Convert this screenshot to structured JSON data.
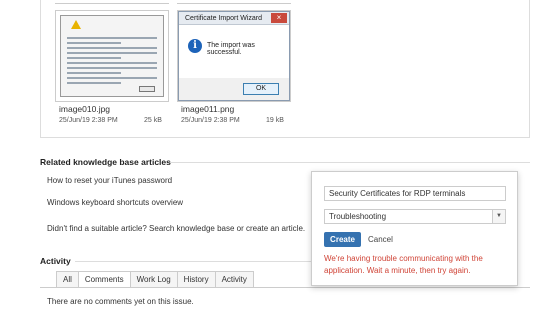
{
  "attachments": [
    {
      "name": "image010.jpg",
      "date": "25/Jun/19 2:38 PM",
      "size": "25 kB"
    },
    {
      "name": "image011.png",
      "date": "25/Jun/19 2:38 PM",
      "size": "19 kB"
    }
  ],
  "dialog_preview": {
    "title": "Certificate Import Wizard",
    "message": "The import was successful.",
    "ok_label": "OK"
  },
  "knowledge_base": {
    "heading": "Related knowledge base articles",
    "articles": [
      "How to reset your iTunes password",
      "Windows keyboard shortcuts overview"
    ],
    "suggest_text": "Didn't find a suitable article? Search knowledge base or create an article."
  },
  "activity": {
    "heading": "Activity",
    "tabs": [
      "All",
      "Comments",
      "Work Log",
      "History",
      "Activity"
    ],
    "active_tab": "Comments",
    "empty_text": "There are no comments yet on this issue."
  },
  "create_article_popup": {
    "title_value": "Security Certificates for RDP terminals",
    "category_value": "Troubleshooting",
    "create_label": "Create",
    "cancel_label": "Cancel",
    "error_text": "We're having trouble communicating with the application. Wait a minute, then try again.",
    "error_color": "#d04437",
    "primary_color": "#3572b0"
  }
}
